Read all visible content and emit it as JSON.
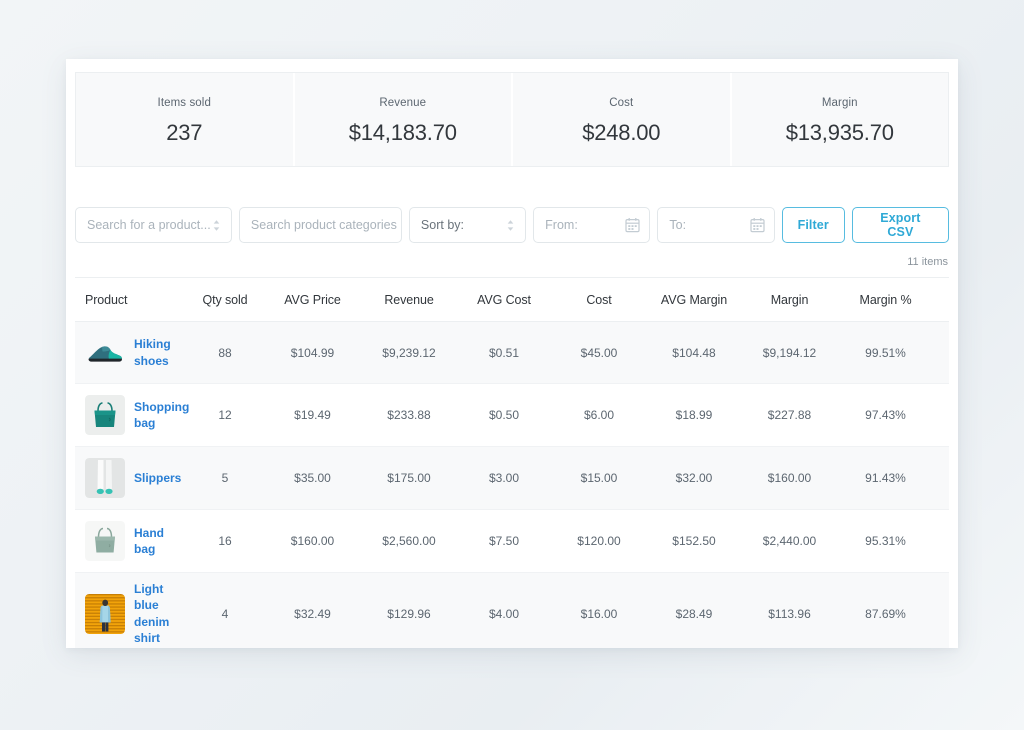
{
  "colors": {
    "accent_button": "#2fa9d6",
    "link": "#2a7fd4",
    "text_dark": "#32373c",
    "text_muted": "#5c6670",
    "panel_bg": "#f8f9fa",
    "page_bg": "#eef2f5"
  },
  "stats": [
    {
      "label": "Items sold",
      "value": "237"
    },
    {
      "label": "Revenue",
      "value": "$14,183.70"
    },
    {
      "label": "Cost",
      "value": "$248.00"
    },
    {
      "label": "Margin",
      "value": "$13,935.70"
    }
  ],
  "filters": {
    "product_search_placeholder": "Search for a product...",
    "category_search_placeholder": "Search product categories",
    "sort_by_label": "Sort by:",
    "date_from_placeholder": "From:",
    "date_to_placeholder": "To:",
    "filter_button": "Filter",
    "export_button": "Export CSV",
    "product_search_value": "",
    "category_search_value": "",
    "date_from_value": "",
    "date_to_value": ""
  },
  "table": {
    "items_count": "11 items",
    "columns": [
      "Product",
      "Qty sold",
      "AVG Price",
      "Revenue",
      "AVG Cost",
      "Cost",
      "AVG Margin",
      "Margin",
      "Margin %"
    ],
    "rows": [
      {
        "product": "Hiking shoes",
        "image": "hiking-shoe-thumbnail",
        "qty_sold": "88",
        "avg_price": "$104.99",
        "revenue": "$9,239.12",
        "avg_cost": "$0.51",
        "cost": "$45.00",
        "avg_margin": "$104.48",
        "margin": "$9,194.12",
        "margin_pct": "99.51%"
      },
      {
        "product": "Shopping bag",
        "image": "teal-tote-bag-thumbnail",
        "qty_sold": "12",
        "avg_price": "$19.49",
        "revenue": "$233.88",
        "avg_cost": "$0.50",
        "cost": "$6.00",
        "avg_margin": "$18.99",
        "margin": "$227.88",
        "margin_pct": "97.43%"
      },
      {
        "product": "Slippers",
        "image": "slippers-thumbnail",
        "qty_sold": "5",
        "avg_price": "$35.00",
        "revenue": "$175.00",
        "avg_cost": "$3.00",
        "cost": "$15.00",
        "avg_margin": "$32.00",
        "margin": "$160.00",
        "margin_pct": "91.43%"
      },
      {
        "product": "Hand bag",
        "image": "sage-handbag-thumbnail",
        "qty_sold": "16",
        "avg_price": "$160.00",
        "revenue": "$2,560.00",
        "avg_cost": "$7.50",
        "cost": "$120.00",
        "avg_margin": "$152.50",
        "margin": "$2,440.00",
        "margin_pct": "95.31%"
      },
      {
        "product": "Light blue denim shirt",
        "image": "denim-shirt-thumbnail",
        "qty_sold": "4",
        "avg_price": "$32.49",
        "revenue": "$129.96",
        "avg_cost": "$4.00",
        "cost": "$16.00",
        "avg_margin": "$28.49",
        "margin": "$113.96",
        "margin_pct": "87.69%"
      }
    ]
  }
}
